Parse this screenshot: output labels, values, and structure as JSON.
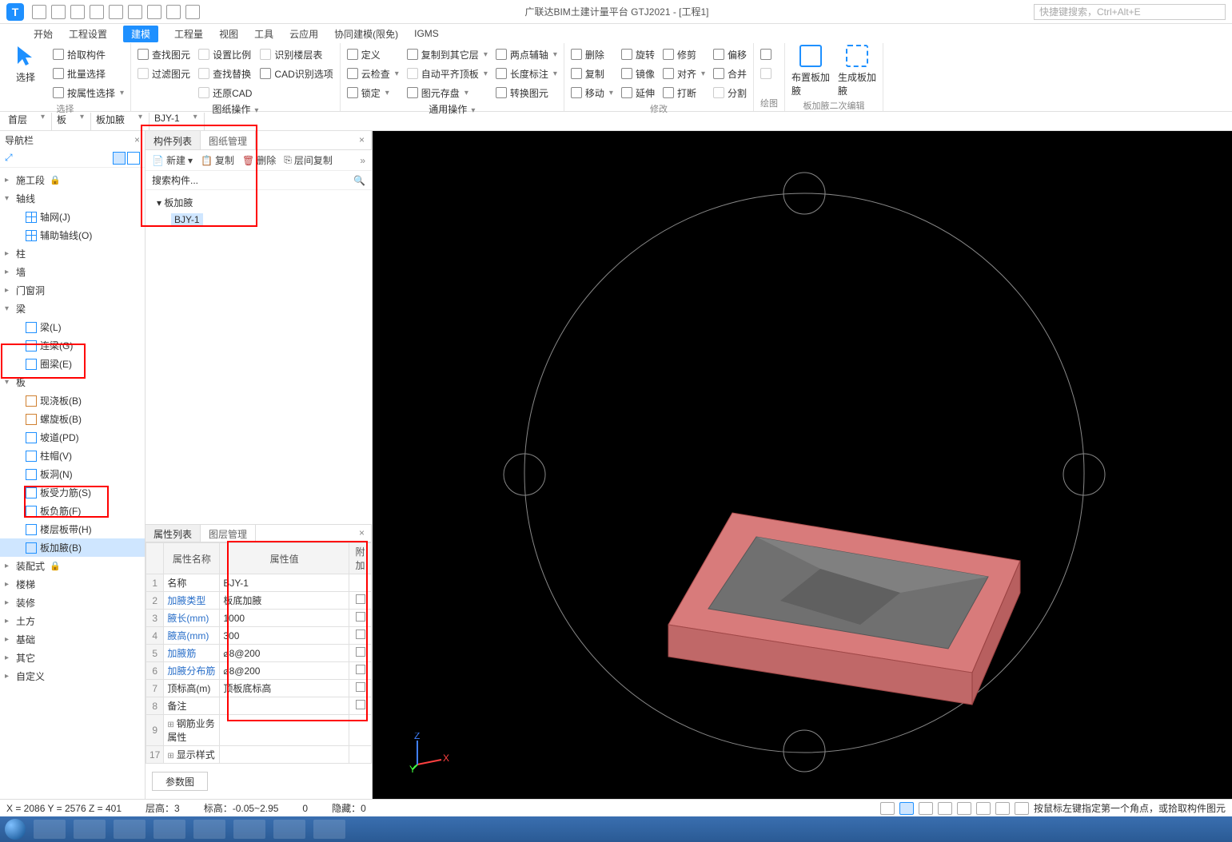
{
  "title": "广联达BIM土建计量平台 GTJ2021 - [工程1]",
  "search_placeholder": "快捷键搜索，Ctrl+Alt+E",
  "menu": [
    "开始",
    "工程设置",
    "建模",
    "工程量",
    "视图",
    "工具",
    "云应用",
    "协同建模(限免)",
    "IGMS"
  ],
  "menu_active": 2,
  "ribbon": {
    "select": {
      "big": "选择",
      "items": [
        "拾取构件",
        "批量选择",
        "按属性选择"
      ],
      "label": "选择"
    },
    "find": {
      "items": [
        "查找图元",
        "过滤图元"
      ],
      "items2": [
        "设置比例",
        "查找替换",
        "还原CAD"
      ],
      "items3": [
        "识别楼层表",
        "CAD识别选项"
      ],
      "label": "图纸操作"
    },
    "define": {
      "items": [
        "定义",
        "云检查",
        "锁定"
      ],
      "items2": [
        "复制到其它层",
        "自动平齐顶板",
        "图元存盘"
      ],
      "items3": [
        "两点辅轴",
        "长度标注",
        "转换图元"
      ],
      "label": "通用操作"
    },
    "modify": {
      "items": [
        "删除",
        "复制",
        "移动"
      ],
      "items2": [
        "旋转",
        "镜像",
        "延伸"
      ],
      "items3": [
        "修剪",
        "对齐",
        "打断"
      ],
      "items4": [
        "偏移",
        "合并",
        "分割"
      ],
      "label": "修改"
    },
    "draw": {
      "label": "绘图"
    },
    "special": {
      "big1": "布置板加腋",
      "big2": "生成板加腋",
      "label": "板加腋二次编辑"
    }
  },
  "filters": [
    "首层",
    "板",
    "板加腋",
    "BJY-1"
  ],
  "nav": {
    "title": "导航栏",
    "groups": [
      {
        "name": "施工段",
        "lock": true
      },
      {
        "name": "轴线",
        "open": true,
        "items": [
          "轴网(J)",
          "辅助轴线(O)"
        ]
      },
      {
        "name": "柱"
      },
      {
        "name": "墙"
      },
      {
        "name": "门窗洞"
      },
      {
        "name": "梁",
        "open": true,
        "items": [
          "梁(L)",
          "连梁(G)",
          "圈梁(E)"
        ]
      },
      {
        "name": "板",
        "open": true,
        "items": [
          "现浇板(B)",
          "螺旋板(B)",
          "坡道(PD)",
          "柱帽(V)",
          "板洞(N)",
          "板受力筋(S)",
          "板负筋(F)",
          "楼层板带(H)",
          "板加腋(B)"
        ],
        "sel": 8
      },
      {
        "name": "装配式",
        "lock": true
      },
      {
        "name": "楼梯"
      },
      {
        "name": "装修"
      },
      {
        "name": "土方"
      },
      {
        "name": "基础"
      },
      {
        "name": "其它"
      },
      {
        "name": "自定义"
      }
    ]
  },
  "complist": {
    "tabs": [
      "构件列表",
      "图纸管理"
    ],
    "tools": [
      "新建",
      "复制",
      "删除",
      "层间复制"
    ],
    "search": "搜索构件...",
    "group": "板加腋",
    "item": "BJY-1"
  },
  "props": {
    "tabs": [
      "属性列表",
      "图层管理"
    ],
    "headers": [
      "",
      "属性名称",
      "属性值",
      "附加"
    ],
    "rows": [
      {
        "n": "1",
        "name": "名称",
        "val": "BJY-1",
        "chk": false,
        "link": false
      },
      {
        "n": "2",
        "name": "加腋类型",
        "val": "板底加腋",
        "chk": true,
        "link": true
      },
      {
        "n": "3",
        "name": "腋长(mm)",
        "val": "1000",
        "chk": true,
        "link": true
      },
      {
        "n": "4",
        "name": "腋高(mm)",
        "val": "300",
        "chk": true,
        "link": true
      },
      {
        "n": "5",
        "name": "加腋筋",
        "val": "⌀8@200",
        "chk": true,
        "link": true
      },
      {
        "n": "6",
        "name": "加腋分布筋",
        "val": "⌀8@200",
        "chk": true,
        "link": true
      },
      {
        "n": "7",
        "name": "顶标高(m)",
        "val": "顶板底标高",
        "chk": true,
        "link": false
      },
      {
        "n": "8",
        "name": "备注",
        "val": "",
        "chk": true,
        "link": false
      },
      {
        "n": "9",
        "name": "钢筋业务属性",
        "val": "",
        "exp": true
      },
      {
        "n": "17",
        "name": "显示样式",
        "val": "",
        "exp": true
      }
    ],
    "parambtn": "参数图"
  },
  "status": {
    "coords": "X = 2086 Y = 2576 Z = 401",
    "floor": "层高：3",
    "elev": "标高：-0.05~2.95",
    "rot": "0",
    "hide": "隐藏：0",
    "hint": "按鼠标左键指定第一个角点，或拾取构件图元"
  }
}
